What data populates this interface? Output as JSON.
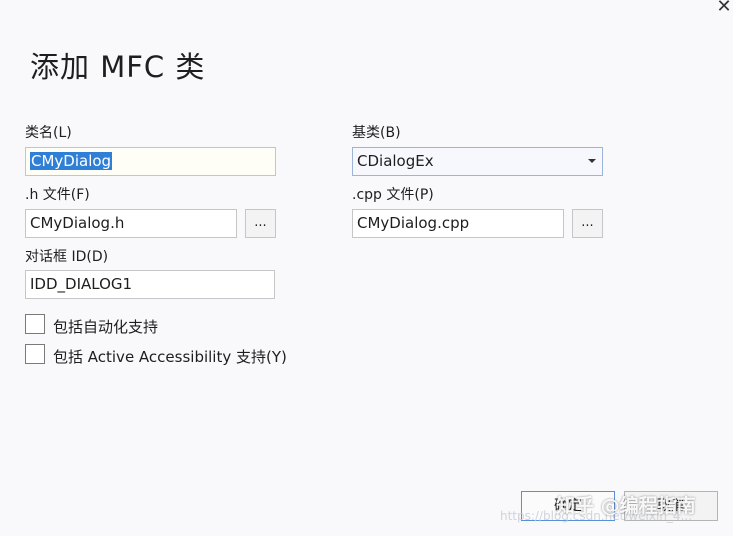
{
  "dialog": {
    "title": "添加 MFC 类",
    "close_glyph": "✕"
  },
  "form": {
    "class_name": {
      "label": "类名(L)",
      "value": "CMyDialog"
    },
    "base_class": {
      "label": "基类(B)",
      "value": "CDialogEx"
    },
    "h_file": {
      "label": ".h 文件(F)",
      "value": "CMyDialog.h",
      "browse": "..."
    },
    "cpp_file": {
      "label": ".cpp 文件(P)",
      "value": "CMyDialog.cpp",
      "browse": "..."
    },
    "dialog_id": {
      "label": "对话框 ID(D)",
      "value": "IDD_DIALOG1"
    },
    "automation": {
      "label": "包括自动化支持",
      "checked": false
    },
    "accessibility": {
      "label": "包括 Active Accessibility 支持(Y)",
      "checked": false
    }
  },
  "buttons": {
    "ok": "确定",
    "cancel": "取消"
  },
  "watermark": {
    "zhihu": "知乎 @编程指南",
    "url": "https://blog.csdn.net/weixin_4..."
  },
  "icons": {
    "close": "close-icon",
    "dropdown": "chevron-down-icon"
  },
  "colors": {
    "background": "#f9f9fb",
    "selection": "#2f7fd6",
    "focus_border": "#e8c373",
    "primary_border": "#5b8fd8"
  }
}
